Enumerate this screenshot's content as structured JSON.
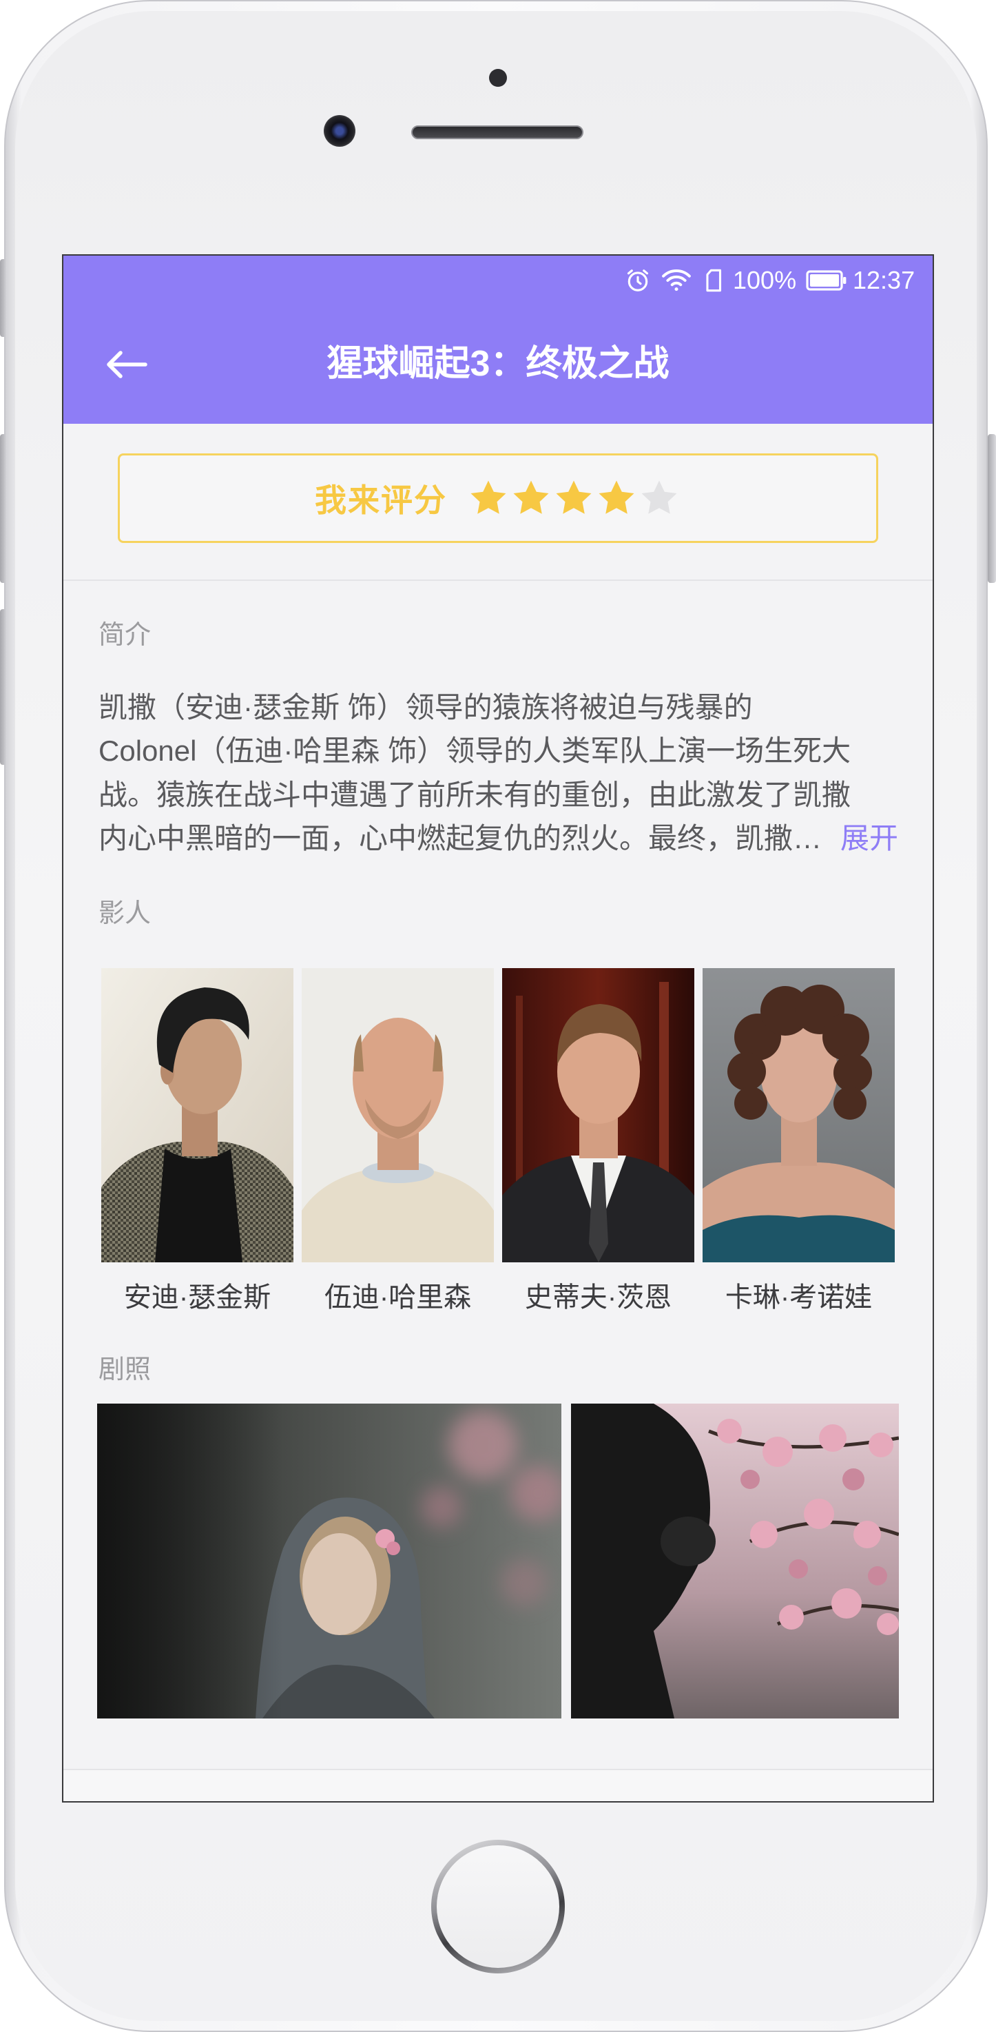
{
  "status_bar": {
    "icons": [
      "alarm-icon",
      "wifi-icon",
      "sim-card-icon",
      "battery-icon"
    ],
    "battery_percent": "100%",
    "battery_level": 1.0,
    "time": "12:37"
  },
  "header": {
    "back_icon": "arrow-left-icon",
    "title": "猩球崛起3：终极之战"
  },
  "rating": {
    "label": "我来评分",
    "value": 4,
    "max": 5
  },
  "intro": {
    "label": "简介",
    "lines": [
      "凯撒（安迪·瑟金斯 饰）领导的猿族将被迫与残暴的",
      "Colonel（伍迪·哈里森 饰）领导的人类军队上演一场生死大",
      "战。猿族在战斗中遭遇了前所未有的重创，由此激发了凯撒",
      "内心中黑暗的一面，心中燃起复仇的烈火。最终，凯撒…"
    ],
    "expand": "展开"
  },
  "cast": {
    "label": "影人",
    "members": [
      {
        "name": "安迪·瑟金斯"
      },
      {
        "name": "伍迪·哈里森"
      },
      {
        "name": "史蒂夫·茨恩"
      },
      {
        "name": "卡琳·考诺娃"
      }
    ]
  },
  "stills": {
    "label": "剧照"
  },
  "colors": {
    "accent": "#8e7df6",
    "rating": "#f7c843",
    "star_empty": "#e2e2e4",
    "rating_border": "#f6d35e"
  }
}
